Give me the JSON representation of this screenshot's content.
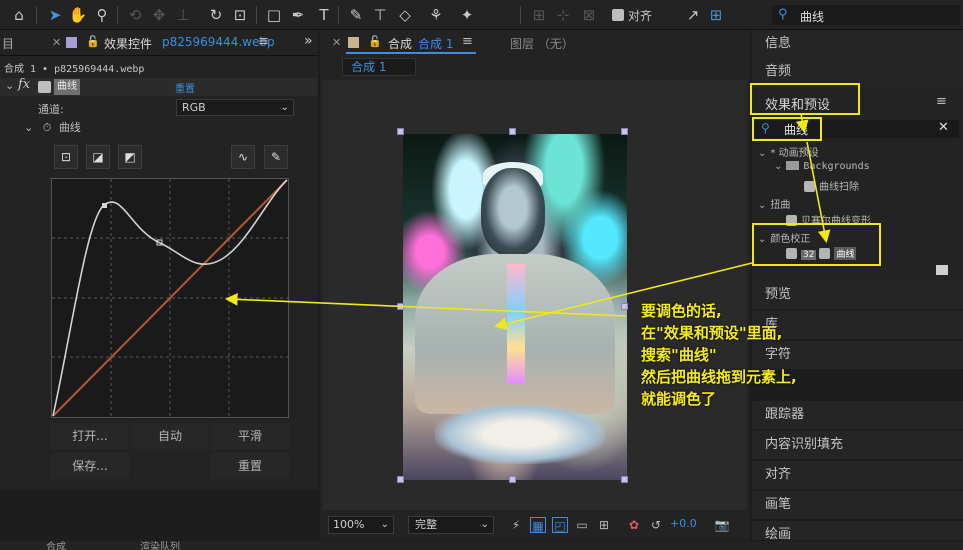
{
  "toolbar": {
    "snap_label": "对齐",
    "search_value": "曲线"
  },
  "effect_controls": {
    "menu_label": "目",
    "tab_title": "效果控件",
    "tab_file": "p825969444.webp",
    "subtitle": "合成 1 • p825969444.webp",
    "effect_name": "曲线",
    "reset_label": "重置",
    "channel_label": "通道:",
    "channel_value": "RGB",
    "curves_label": "曲线",
    "buttons": {
      "open": "打开...",
      "auto": "自动",
      "smooth": "平滑",
      "save": "保存...",
      "reset": "重置"
    }
  },
  "composition": {
    "tab_title": "合成",
    "tab_comp_name": "合成 1",
    "layer_tab": "图层 （无）",
    "comp_button": "合成 1",
    "zoom": "100%",
    "quality": "完整",
    "exposure": "+0.0"
  },
  "right_panel": {
    "info": "信息",
    "audio": "音频",
    "effects_presets": "效果和预设",
    "search_value": "曲线",
    "tree": {
      "anim_presets": "* 动画预设",
      "backgrounds": "Backgrounds",
      "curves_sweep": "曲线扫除",
      "distort": "扭曲",
      "bezier_warp": "贝塞尔曲线变形",
      "color_correction": "颜色校正",
      "bit_badge": "32",
      "curves": "曲线"
    },
    "preview": "预览",
    "library": "库",
    "character": "字符",
    "tracker": "跟踪器",
    "content_aware": "内容识别填充",
    "align": "对齐",
    "brush": "画笔",
    "paint": "绘画"
  },
  "annotation": {
    "lines": [
      "要调色的话,",
      "在\"效果和预设\"里面,",
      "搜索\"曲线\"",
      "然后把曲线拖到元素上,",
      "就能调色了"
    ]
  },
  "statusbar": {
    "left": "合成",
    "right": "渲染队列"
  }
}
